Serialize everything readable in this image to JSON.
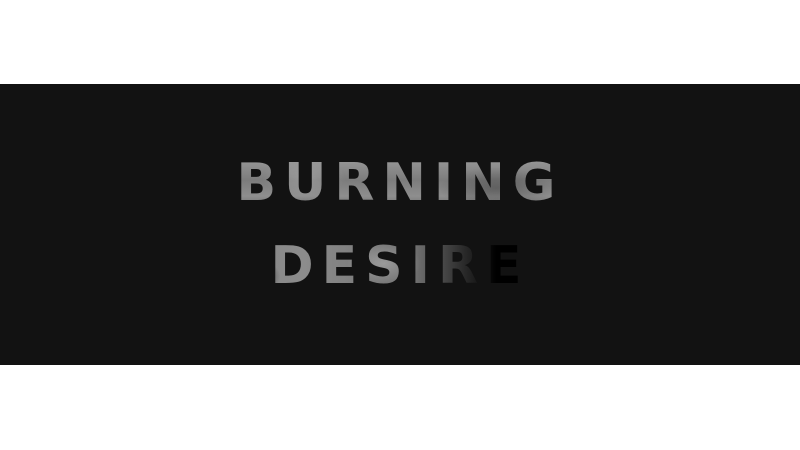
{
  "hero": {
    "title_line_1": "BURNING",
    "title_line_2": "DESIRE"
  },
  "colors": {
    "page_background": "#ffffff",
    "banner_background": "#121212",
    "text_light": "#8c8c8c",
    "text_dark": "#000000"
  }
}
